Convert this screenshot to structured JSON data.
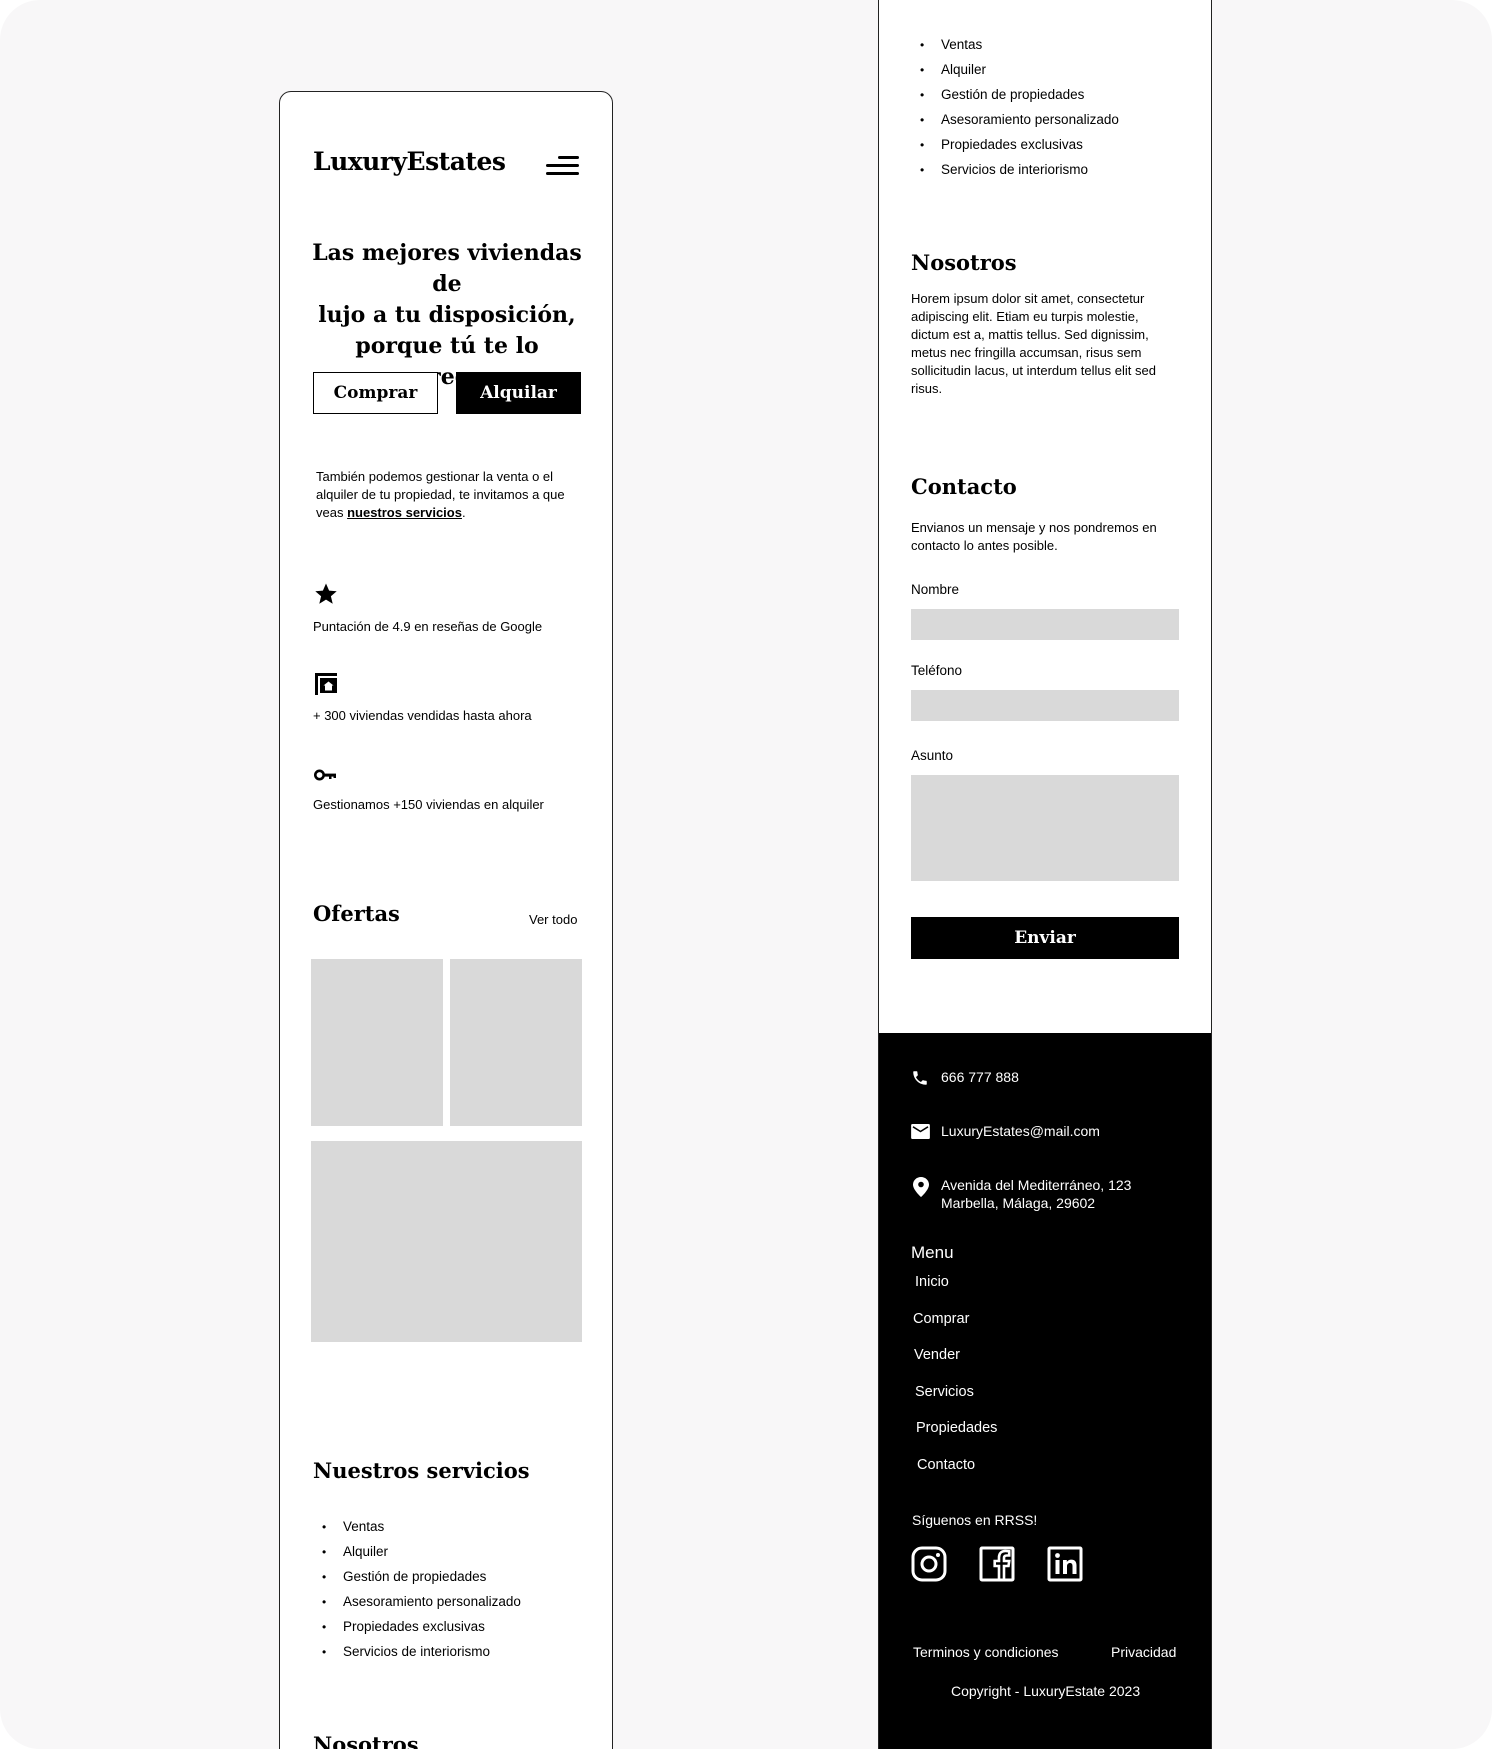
{
  "brand": {
    "logo_text": "LuxuryEstates"
  },
  "hero": {
    "title_line1": "Las mejores viviendas de",
    "title_line2": "lujo a tu disposición,",
    "title_line3": "porque tú te lo mereces.",
    "buy_label": "Comprar",
    "rent_label": "Alquilar"
  },
  "intro": {
    "line1": "También podemos gestionar la venta o el",
    "line2": "alquiler de tu propiedad, te invitamos a que",
    "line3_prefix": "veas ",
    "link_text": "nuestros servicios",
    "line3_suffix": "."
  },
  "stats": [
    {
      "icon": "star-icon",
      "text": "Puntación de 4.9 en reseñas de Google"
    },
    {
      "icon": "house-sign-icon",
      "text": "+ 300 viviendas vendidas hasta ahora"
    },
    {
      "icon": "key-icon",
      "text": "Gestionamos +150 viviendas en alquiler"
    }
  ],
  "offers": {
    "title": "Ofertas",
    "see_all": "Ver todo"
  },
  "services": {
    "title": "Nuestros servicios",
    "items": [
      "Ventas",
      "Alquiler",
      "Gestión de propiedades",
      "Asesoramiento personalizado",
      "Propiedades exclusivas",
      "Servicios de interiorismo"
    ]
  },
  "about": {
    "title": "Nosotros",
    "lines": [
      "Horem ipsum dolor sit amet, consectetur",
      "adipiscing elit. Etiam eu turpis molestie,",
      "dictum est a, mattis tellus. Sed dignissim,",
      "metus nec fringilla accumsan, risus sem",
      "sollicitudin lacus, ut interdum tellus elit sed",
      "risus."
    ]
  },
  "contact": {
    "title": "Contacto",
    "line1": "Envianos un mensaje y nos pondremos en",
    "line2": "contacto lo antes posible.",
    "name_label": "Nombre",
    "phone_label": "Teléfono",
    "subject_label": "Asunto",
    "name_value": "",
    "phone_value": "",
    "subject_value": "",
    "send_label": "Enviar"
  },
  "footer": {
    "phone": "666 777 888",
    "email": "LuxuryEstates@mail.com",
    "address_line1": "Avenida del Mediterráneo, 123",
    "address_line2": "Marbella, Málaga, 29602",
    "menu_title": "Menu",
    "menu_items": [
      "Inicio",
      "Comprar",
      "Vender",
      "Servicios",
      "Propiedades",
      "Contacto"
    ],
    "follow_text": "Síguenos en RRSS!",
    "social": [
      "instagram-icon",
      "facebook-icon",
      "linkedin-icon"
    ],
    "terms": "Terminos y condiciones",
    "privacy": "Privacidad",
    "copyright": "Copyright - LuxuryEstate 2023"
  },
  "colors": {
    "primary": "#000000",
    "placeholder": "#d9d9d9",
    "page_bg": "#f8f7f8",
    "surface": "#ffffff"
  }
}
